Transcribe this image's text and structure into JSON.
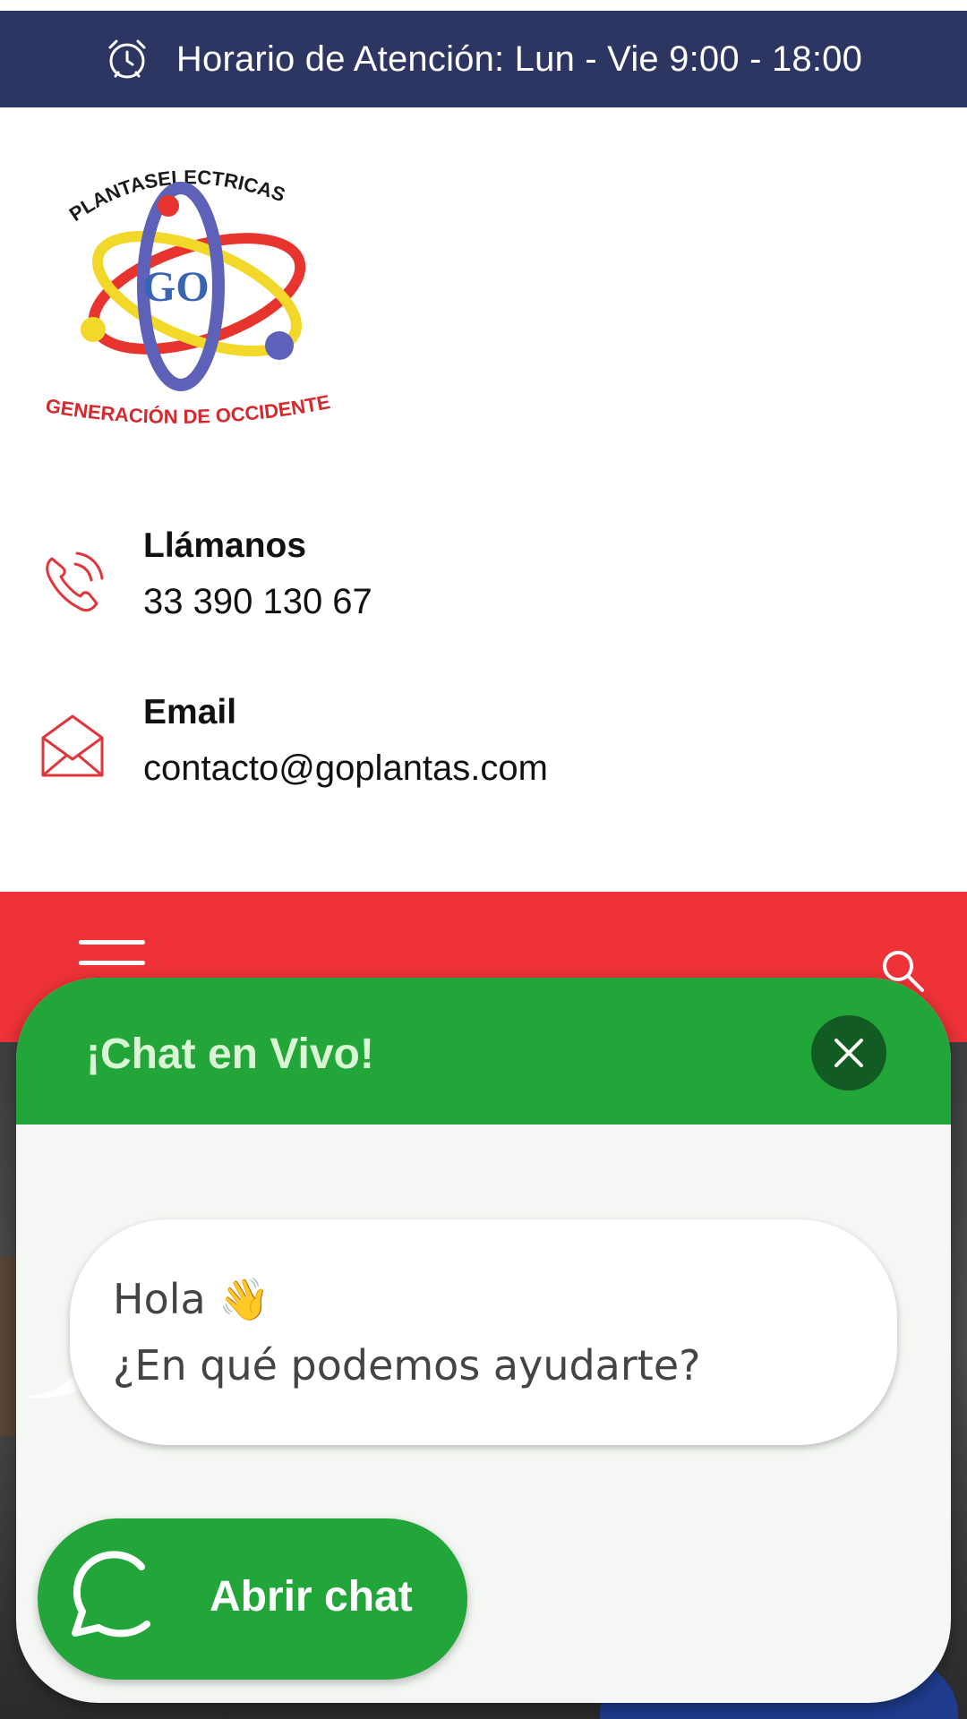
{
  "topbar": {
    "hours_text": "Horario de Atención: Lun - Vie 9:00 - 18:00",
    "icon": "alarm-clock-icon"
  },
  "logo": {
    "arc_text": "PLANTASELECTRICAS",
    "center_text": "GO",
    "bottom_text": "GENERACIÓN DE OCCIDENTE"
  },
  "contacts": [
    {
      "label": "Llámanos",
      "value": "33 390 130 67",
      "icon": "phone-icon"
    },
    {
      "label": "Email",
      "value": "contacto@goplantas.com",
      "icon": "envelope-icon"
    }
  ],
  "navbar": {
    "menu_icon": "hamburger-menu-icon",
    "search_icon": "search-icon"
  },
  "chat_widget": {
    "title": "¡Chat en Vivo!",
    "close_icon": "close-icon",
    "greeting": "Hola 👋",
    "question": "¿En qué podemos ayudarte?",
    "open_button_label": "Abrir chat",
    "open_button_icon": "chat-bubble-icon"
  },
  "colors": {
    "topbar_bg": "#2d3663",
    "accent_red": "#ee3237",
    "chat_green": "#22a63a",
    "close_dark_green": "#135b24"
  }
}
